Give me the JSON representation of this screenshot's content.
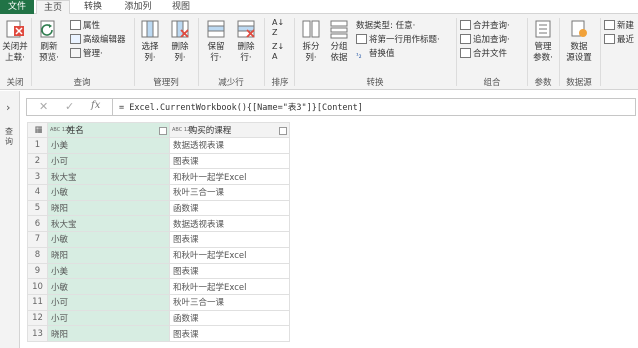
{
  "tabs": [
    "文件",
    "主页",
    "转换",
    "添加列",
    "视图"
  ],
  "ribbon": {
    "close": {
      "b1": "关闭并",
      "b2": "上载·",
      "label": "关闭"
    },
    "query": {
      "refresh1": "刷新",
      "refresh2": "预览·",
      "props": "属性",
      "adv": "高级编辑器",
      "manage": "管理·",
      "label": "查询"
    },
    "cols": {
      "choose1": "选择",
      "choose2": "列·",
      "remove1": "删除",
      "remove2": "列·",
      "label": "管理列"
    },
    "rows": {
      "keep1": "保留",
      "keep2": "行·",
      "del1": "删除",
      "del2": "行·",
      "label": "减少行"
    },
    "sort": {
      "label": "排序"
    },
    "transform": {
      "split1": "拆分",
      "split2": "列·",
      "group1": "分组",
      "group2": "依据",
      "dtype": "数据类型: 任意·",
      "firstrow": "将第一行用作标题·",
      "replace": "替换值",
      "label": "转换"
    },
    "combine": {
      "merge": "合并查询·",
      "append": "追加查询·",
      "files": "合并文件",
      "label": "组合"
    },
    "params": {
      "b1": "管理",
      "b2": "参数·",
      "label": "参数"
    },
    "source": {
      "b1": "数据",
      "b2": "源设置",
      "label": "数据源"
    },
    "newq": {
      "new": "新建",
      "recent": "最近"
    }
  },
  "leftpane": {
    "label": "查询"
  },
  "formula": "= Excel.CurrentWorkbook(){[Name=\"表3\"]}[Content]",
  "grid": {
    "type_tag": "ABC 123",
    "columns": [
      "姓名",
      "购买的课程"
    ],
    "rows": [
      [
        "小美",
        "数据透视表课"
      ],
      [
        "小可",
        "图表课"
      ],
      [
        "秋大宝",
        "和秋叶一起学Excel"
      ],
      [
        "小敏",
        "秋叶三合一课"
      ],
      [
        "晓阳",
        "函数课"
      ],
      [
        "秋大宝",
        "数据透视表课"
      ],
      [
        "小敏",
        "图表课"
      ],
      [
        "晓阳",
        "和秋叶一起学Excel"
      ],
      [
        "小美",
        "图表课"
      ],
      [
        "小敏",
        "和秋叶一起学Excel"
      ],
      [
        "小可",
        "秋叶三合一课"
      ],
      [
        "小可",
        "函数课"
      ],
      [
        "晓阳",
        "图表课"
      ]
    ]
  }
}
